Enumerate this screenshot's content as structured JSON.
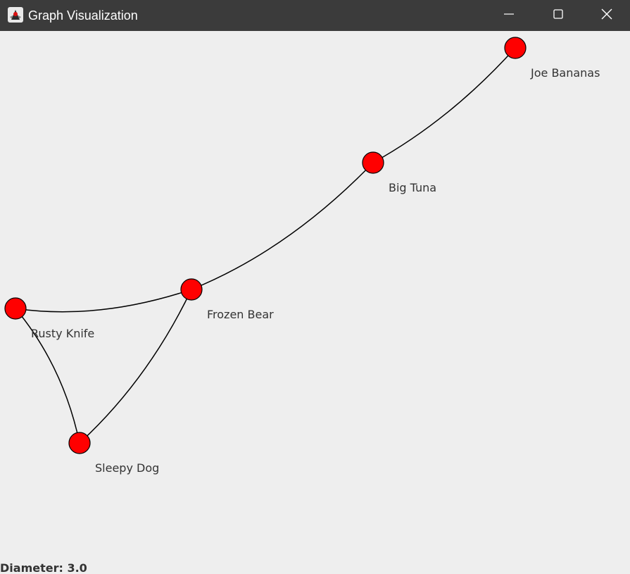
{
  "window": {
    "title": "Graph Visualization",
    "app_icon": "java-duke-icon",
    "controls": {
      "minimize_icon": "minimize-icon",
      "maximize_icon": "maximize-icon",
      "close_icon": "close-icon"
    }
  },
  "graph": {
    "node_color": "#ff0000",
    "edge_color": "#000000",
    "background": "#eeeeee",
    "nodes": [
      {
        "id": "joe",
        "label": "Joe Bananas"
      },
      {
        "id": "tuna",
        "label": "Big Tuna"
      },
      {
        "id": "bear",
        "label": "Frozen Bear"
      },
      {
        "id": "knife",
        "label": "Rusty Knife"
      },
      {
        "id": "dog",
        "label": "Sleepy Dog"
      }
    ],
    "edges": [
      {
        "from": "joe",
        "to": "tuna"
      },
      {
        "from": "tuna",
        "to": "bear"
      },
      {
        "from": "bear",
        "to": "knife"
      },
      {
        "from": "bear",
        "to": "dog"
      },
      {
        "from": "knife",
        "to": "dog"
      }
    ]
  },
  "status": {
    "diameter_text": "Diameter: 3.0"
  }
}
